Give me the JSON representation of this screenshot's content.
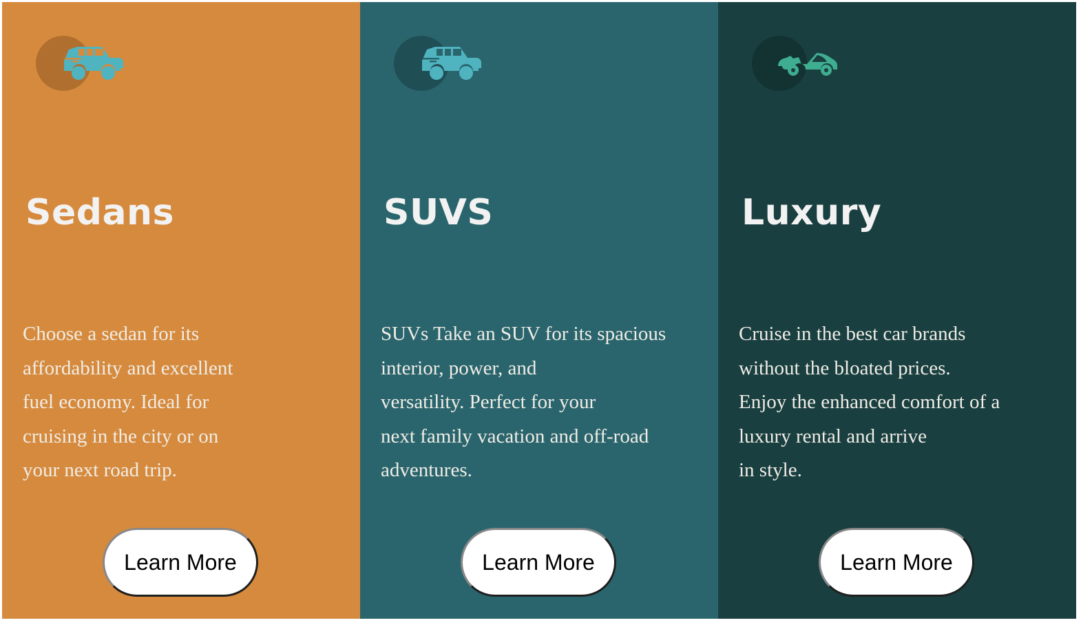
{
  "theme": {
    "sedans_bg": "#d68a3d",
    "suvs_bg": "#2a656d",
    "luxury_bg": "#193f40",
    "title_color": "#f2f2f2",
    "text_color": "#f0ede6",
    "icon_teal": "#4fb4c0",
    "icon_green": "#3fae90"
  },
  "cards": [
    {
      "icon": "suv-car-icon",
      "title": "Sedans",
      "text": "Choose a sedan for its\naffordability and excellent\nfuel economy. Ideal for\ncruising in the city or on\nyour next road trip.",
      "button": "Learn More"
    },
    {
      "icon": "suv-car-icon",
      "title": "SUVS",
      "text": "SUVs Take an SUV for its spacious\ninterior, power, and\nversatility. Perfect for your\nnext family vacation and off-road\nadventures.",
      "button": "Learn More"
    },
    {
      "icon": "convertible-car-icon",
      "title": "Luxury",
      "text": "Cruise in the best car brands\nwithout the bloated prices.\nEnjoy the enhanced comfort of a\nluxury rental and arrive\nin style.",
      "button": "Learn More"
    }
  ]
}
